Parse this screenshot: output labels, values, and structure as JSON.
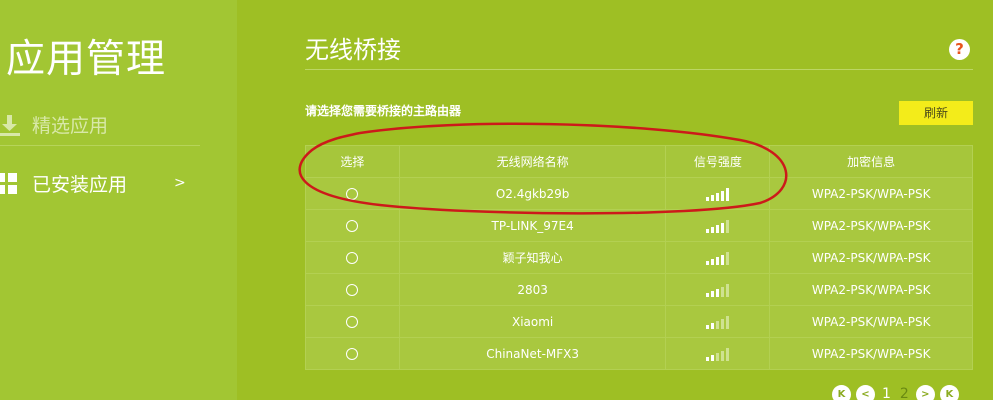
{
  "app": {
    "title": "应用管理"
  },
  "sidebar": {
    "items": [
      {
        "label": "精选应用",
        "icon": "download-icon"
      },
      {
        "label": "已安装应用",
        "icon": "grid-icon",
        "chevron": ">"
      }
    ]
  },
  "main": {
    "title": "无线桥接",
    "help": "?",
    "subtitle": "请选择您需要桥接的主路由器",
    "refresh_label": "刷新"
  },
  "table": {
    "headers": [
      "选择",
      "无线网络名称",
      "信号强度",
      "加密信息"
    ],
    "rows": [
      {
        "ssid": "O2.4gkb29b",
        "signal": 5,
        "security": "WPA2-PSK/WPA-PSK"
      },
      {
        "ssid": "TP-LINK_97E4",
        "signal": 4,
        "security": "WPA2-PSK/WPA-PSK"
      },
      {
        "ssid": "颖子知我心",
        "signal": 4,
        "security": "WPA2-PSK/WPA-PSK"
      },
      {
        "ssid": "2803",
        "signal": 3,
        "security": "WPA2-PSK/WPA-PSK"
      },
      {
        "ssid": "Xiaomi",
        "signal": 2,
        "security": "WPA2-PSK/WPA-PSK"
      },
      {
        "ssid": "ChinaNet-MFX3",
        "signal": 2,
        "security": "WPA2-PSK/WPA-PSK"
      }
    ]
  },
  "pagination": {
    "first": "K",
    "prev": "<",
    "pages": [
      "1",
      "2"
    ],
    "current": "2",
    "next": ">",
    "last": "K"
  },
  "colors": {
    "background": "#9ebf24",
    "sidebar": "#a2c633",
    "accent_button": "#f3ec1a",
    "annotation": "#cc1a1a"
  }
}
